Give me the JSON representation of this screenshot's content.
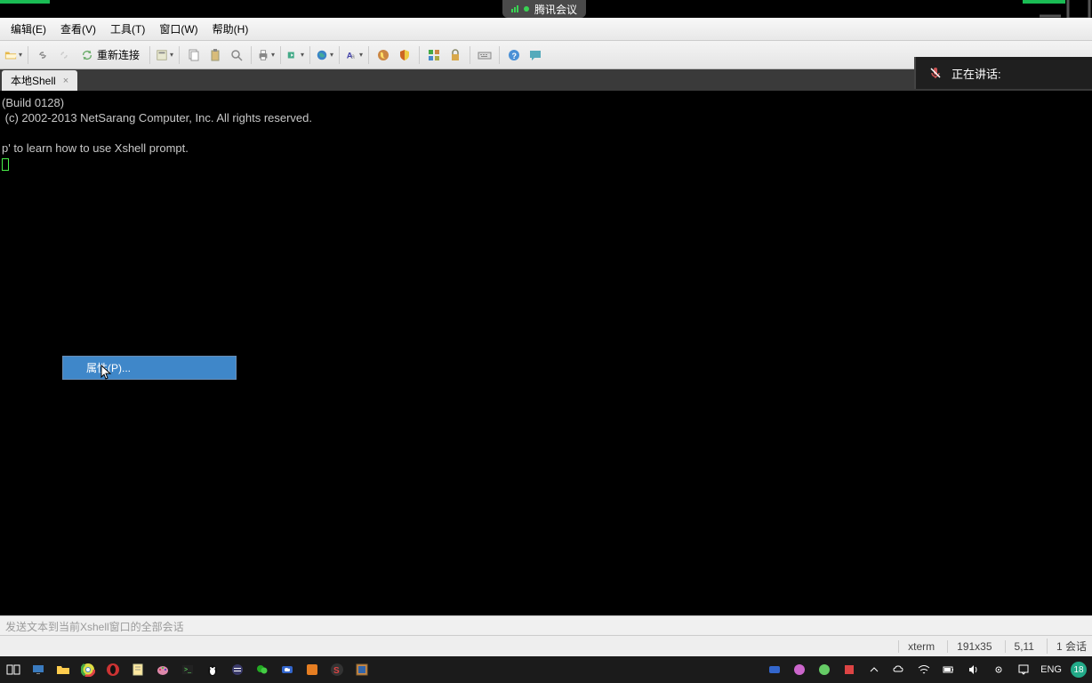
{
  "top_notify": {
    "label": "腾讯会议"
  },
  "menu": {
    "edit": "编辑(E)",
    "view": "查看(V)",
    "tools": "工具(T)",
    "window": "窗口(W)",
    "help": "帮助(H)"
  },
  "toolbar": {
    "reconnect": "重新连接"
  },
  "tab": {
    "title": "本地Shell"
  },
  "speaking": {
    "label": "正在讲话:"
  },
  "terminal": {
    "line1": "(Build 0128)",
    "line2": " (c) 2002-2013 NetSarang Computer, Inc. All rights reserved.",
    "line3": "",
    "line4": "p' to learn how to use Xshell prompt."
  },
  "ctx": {
    "properties": "属性(P)..."
  },
  "sendbar": {
    "placeholder": "发送文本到当前Xshell窗口的全部会话"
  },
  "status": {
    "term": "xterm",
    "size": "191x35",
    "pos": "5,11",
    "sessions": "1 会话"
  },
  "tray": {
    "lang": "ENG",
    "time": "18"
  }
}
